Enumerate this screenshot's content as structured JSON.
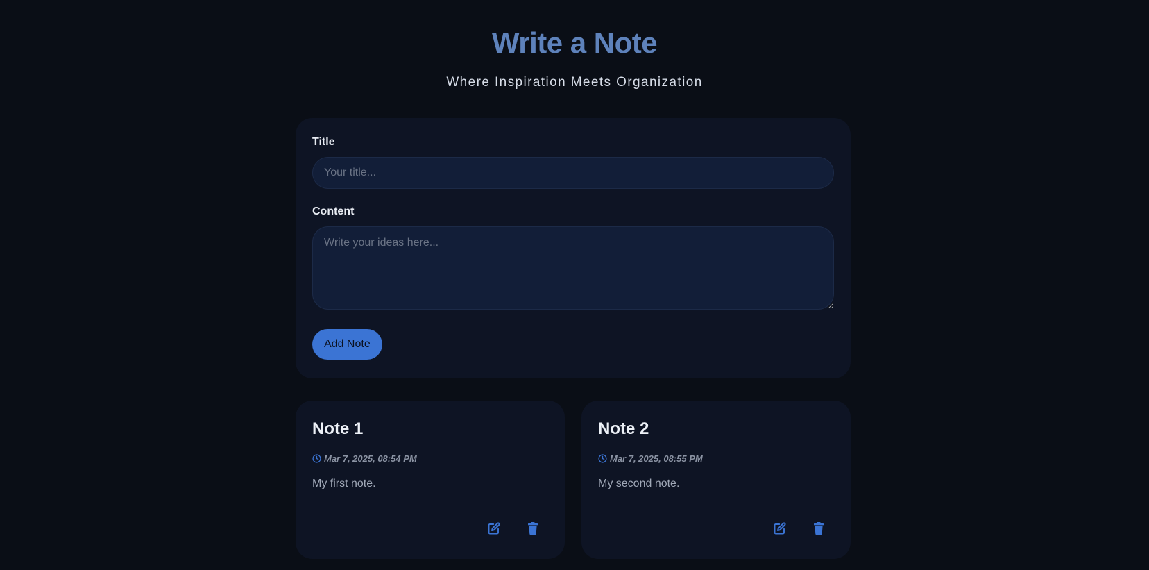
{
  "header": {
    "title": "Write a Note",
    "subtitle": "Where Inspiration Meets Organization"
  },
  "form": {
    "title_label": "Title",
    "title_placeholder": "Your title...",
    "title_value": "",
    "content_label": "Content",
    "content_placeholder": "Write your ideas here...",
    "content_value": "",
    "add_button_label": "Add Note"
  },
  "notes": [
    {
      "title": "Note 1",
      "timestamp": "Mar 7, 2025, 08:54 PM",
      "body": "My first note.",
      "icons": [
        "clock-icon",
        "edit-icon",
        "trash-icon"
      ]
    },
    {
      "title": "Note 2",
      "timestamp": "Mar 7, 2025, 08:55 PM",
      "body": "My second note.",
      "icons": [
        "clock-icon",
        "edit-icon",
        "trash-icon"
      ]
    }
  ],
  "colors": {
    "background": "#0a0e16",
    "card": "#0e1424",
    "input": "#121e38",
    "accent": "#3b74d4",
    "title": "#5e82bb"
  }
}
